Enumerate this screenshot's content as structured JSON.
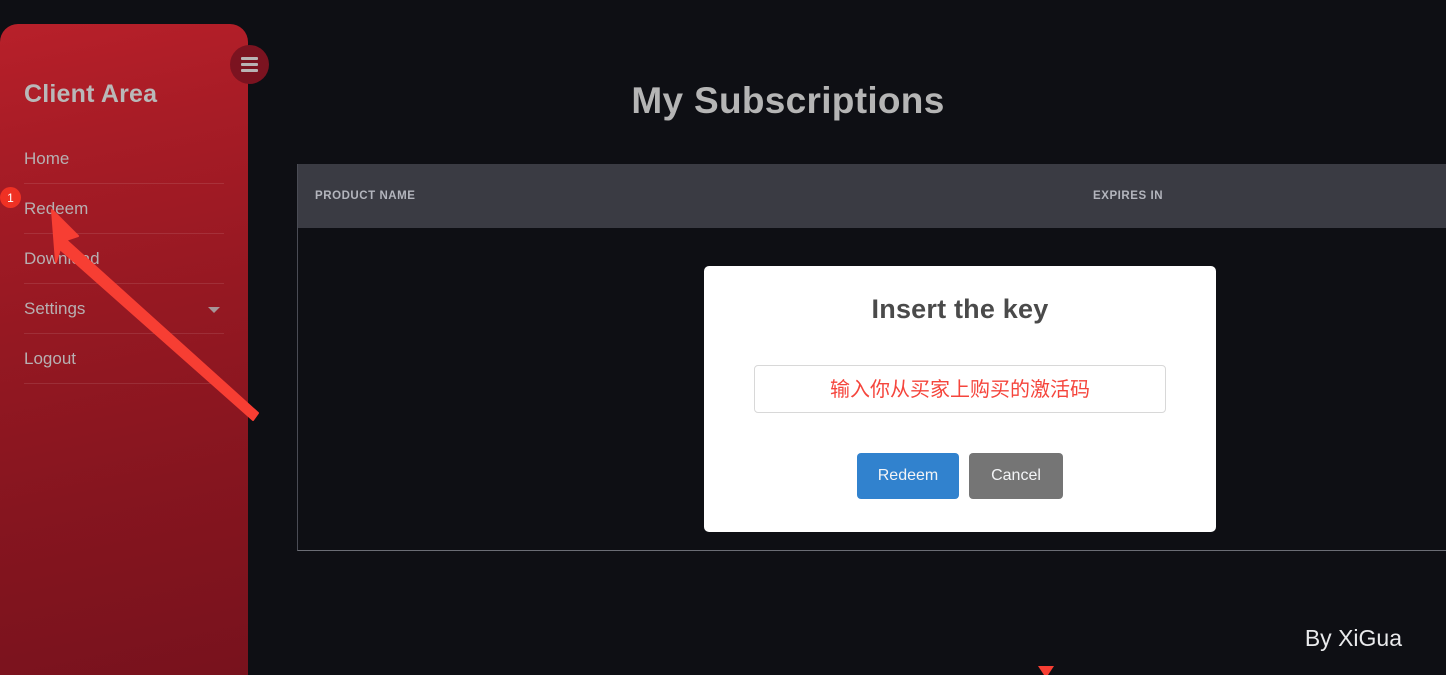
{
  "sidebar": {
    "title": "Client Area",
    "menu_icon": "hamburger-icon",
    "items": [
      {
        "label": "Home",
        "has_caret": false
      },
      {
        "label": "Redeem",
        "has_caret": false
      },
      {
        "label": "Download",
        "has_caret": false
      },
      {
        "label": "Settings",
        "has_caret": true
      },
      {
        "label": "Logout",
        "has_caret": false
      }
    ]
  },
  "main": {
    "page_title": "My Subscriptions",
    "table": {
      "columns": [
        "PRODUCT NAME",
        "EXPIRES IN"
      ],
      "rows": []
    }
  },
  "modal": {
    "title": "Insert the key",
    "input_value": "输入你从买家上购买的激活码",
    "input_placeholder": "输入你从买家上购买的激活码",
    "redeem_label": "Redeem",
    "cancel_label": "Cancel"
  },
  "footer": {
    "credit": "By XiGua"
  },
  "annotations": {
    "step_badge": "1",
    "arrow_target": "Redeem"
  },
  "colors": {
    "sidebar_top": "#b8202a",
    "sidebar_bottom": "#78121d",
    "page_background": "#0e0f14",
    "table_header": "#3a3b43",
    "redeem_button": "#3182ce",
    "cancel_button": "#757575",
    "input_text": "#f5453c",
    "annotation_red": "#f73e33"
  }
}
